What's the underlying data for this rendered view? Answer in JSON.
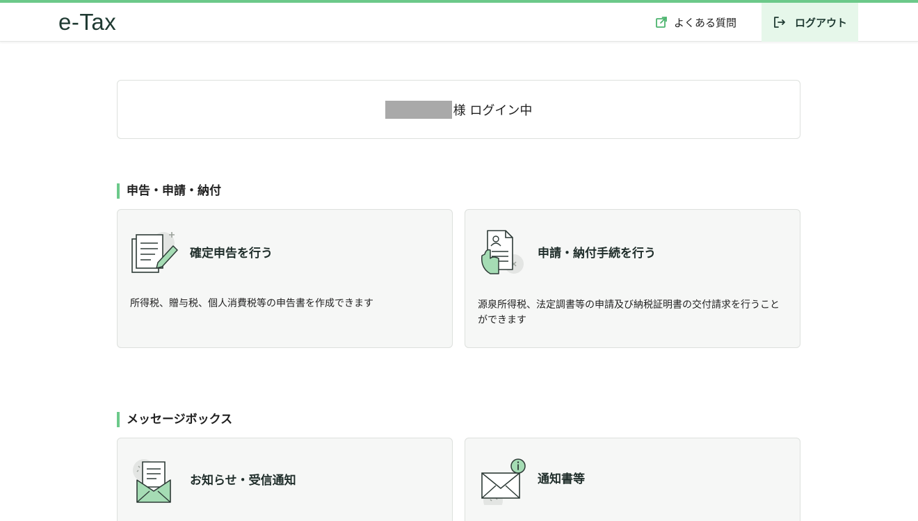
{
  "header": {
    "logo": "e-Tax",
    "faq_label": "よくある質問",
    "logout_label": "ログアウト"
  },
  "login": {
    "status_text": "様 ログイン中"
  },
  "sections": {
    "filing": {
      "title": "申告・申請・納付",
      "cards": [
        {
          "title": "確定申告を行う",
          "description": "所得税、贈与税、個人消費税等の申告書を作成できます"
        },
        {
          "title": "申請・納付手続を行う",
          "description": "源泉所得税、法定調書等の申請及び納税証明書の交付請求を行うことができます"
        }
      ]
    },
    "messagebox": {
      "title": "メッセージボックス",
      "cards": [
        {
          "title": "お知らせ・受信通知"
        },
        {
          "title": "通知書等"
        }
      ]
    }
  },
  "colors": {
    "accent": "#6cc98a",
    "accent_light": "#e6f7ea",
    "brand_dark": "#1f3a32",
    "card_bg": "#f6f7f6"
  },
  "icons": {
    "faq": "external-link-icon",
    "logout": "logout-icon",
    "filing_card": "document-pen-icon",
    "application_card": "hand-document-icon",
    "notice_card": "letter-envelope-icon",
    "notification_card": "envelope-info-icon"
  }
}
